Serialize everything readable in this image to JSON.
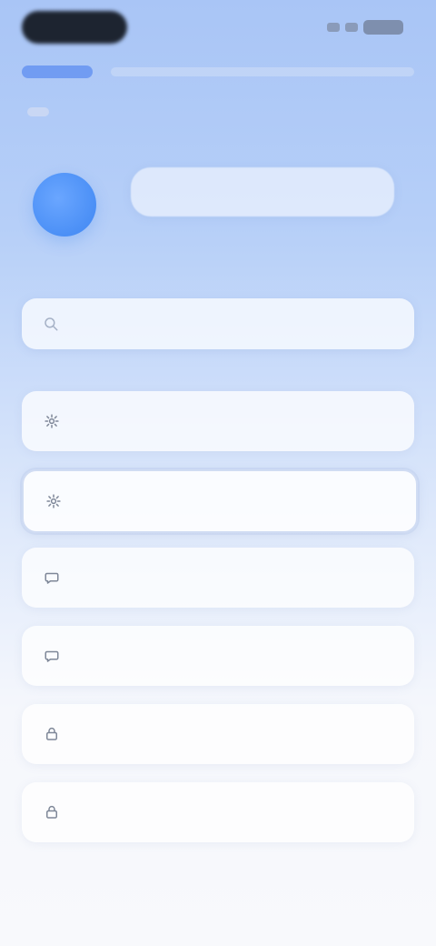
{
  "profile": {
    "name_placeholder": ""
  },
  "search": {
    "placeholder": "",
    "value": ""
  },
  "list": {
    "items": [
      {
        "label": "",
        "icon": "gear-icon",
        "selected": false
      },
      {
        "label": "",
        "icon": "gear-icon",
        "selected": true
      },
      {
        "label": "",
        "icon": "chat-icon",
        "selected": false
      },
      {
        "label": "",
        "icon": "chat-icon",
        "selected": false
      },
      {
        "label": "",
        "icon": "lock-icon",
        "selected": false
      },
      {
        "label": "",
        "icon": "lock-icon",
        "selected": false
      }
    ]
  },
  "colors": {
    "accent": "#3e86f2",
    "background_top": "#a9c5f6",
    "background_bottom": "#f8f9fc"
  }
}
